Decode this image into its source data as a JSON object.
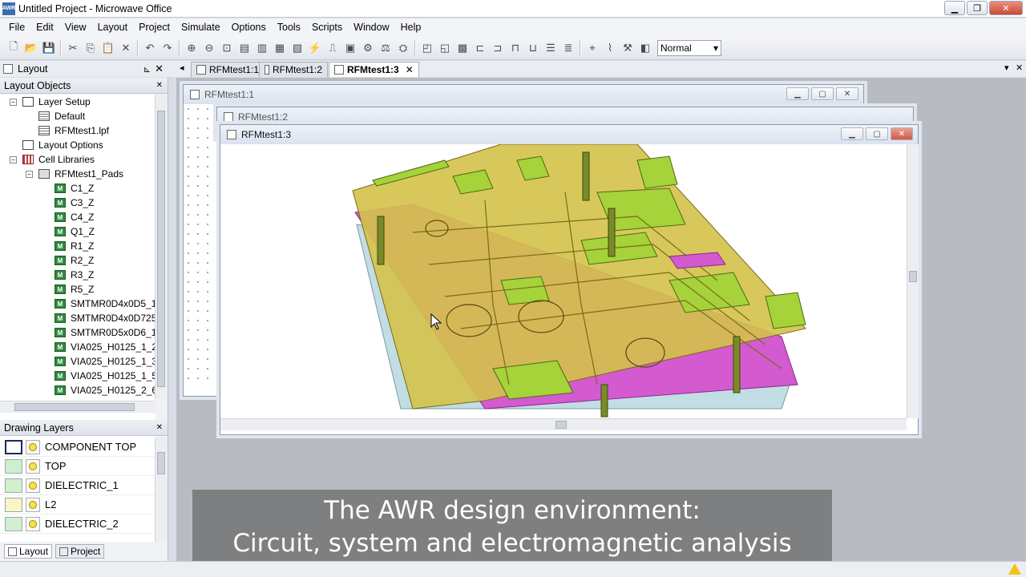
{
  "window": {
    "title": "Untitled Project - Microwave Office",
    "app_icon": "AWR"
  },
  "menu": [
    "File",
    "Edit",
    "View",
    "Layout",
    "Project",
    "Simulate",
    "Options",
    "Tools",
    "Scripts",
    "Window",
    "Help"
  ],
  "toolbar": {
    "mode_select": "Normal"
  },
  "left_panel": {
    "title": "Layout",
    "section_objects": "Layout Objects",
    "tree": [
      {
        "label": "Layer Setup",
        "level": 1,
        "icon": "folder",
        "exp": "−"
      },
      {
        "label": "Default",
        "level": 2,
        "icon": "doc"
      },
      {
        "label": "RFMtest1.lpf",
        "level": 2,
        "icon": "doc"
      },
      {
        "label": "Layout Options",
        "level": 1,
        "icon": "folder"
      },
      {
        "label": "Cell Libraries",
        "level": 1,
        "icon": "lib",
        "exp": "−"
      },
      {
        "label": "RFMtest1_Pads",
        "level": 2,
        "icon": "gds",
        "exp": "−"
      },
      {
        "label": "C1_Z",
        "level": 3,
        "icon": "m"
      },
      {
        "label": "C3_Z",
        "level": 3,
        "icon": "m"
      },
      {
        "label": "C4_Z",
        "level": 3,
        "icon": "m"
      },
      {
        "label": "Q1_Z",
        "level": 3,
        "icon": "m"
      },
      {
        "label": "R1_Z",
        "level": 3,
        "icon": "m"
      },
      {
        "label": "R2_Z",
        "level": 3,
        "icon": "m"
      },
      {
        "label": "R3_Z",
        "level": 3,
        "icon": "m"
      },
      {
        "label": "R5_Z",
        "level": 3,
        "icon": "m"
      },
      {
        "label": "SMTMR0D4x0D5_1",
        "level": 3,
        "icon": "m"
      },
      {
        "label": "SMTMR0D4x0D725",
        "level": 3,
        "icon": "m"
      },
      {
        "label": "SMTMR0D5x0D6_1",
        "level": 3,
        "icon": "m"
      },
      {
        "label": "VIA025_H0125_1_2",
        "level": 3,
        "icon": "m"
      },
      {
        "label": "VIA025_H0125_1_3",
        "level": 3,
        "icon": "m"
      },
      {
        "label": "VIA025_H0125_1_5",
        "level": 3,
        "icon": "m"
      },
      {
        "label": "VIA025_H0125_2_6",
        "level": 3,
        "icon": "m"
      }
    ],
    "section_layers": "Drawing Layers",
    "layers": [
      {
        "name": "COMPONENT TOP",
        "color": "#ffffff"
      },
      {
        "name": "TOP",
        "color": "#cfeecb"
      },
      {
        "name": "DIELECTRIC_1",
        "color": "#d4efd0"
      },
      {
        "name": "L2",
        "color": "#fbf4c6"
      },
      {
        "name": "DIELECTRIC_2",
        "color": "#d4efd0"
      }
    ],
    "bottom_tabs": [
      "Layout",
      "Project"
    ]
  },
  "doc_tabs": [
    "RFMtest1:1",
    "RFMtest1:2",
    "RFMtest1:3"
  ],
  "windows": {
    "w1": "RFMtest1:1",
    "w2": "RFMtest1:2",
    "w3": "RFMtest1:3"
  },
  "caption": {
    "line1": "The AWR design environment:",
    "line2": "Circuit, system and electromagnetic analysis"
  },
  "colors": {
    "pcb_yellow": "#d4c24a",
    "pcb_magenta": "#d45ad0",
    "pcb_green": "#a6d23a",
    "pcb_blue": "#c2dde4"
  }
}
